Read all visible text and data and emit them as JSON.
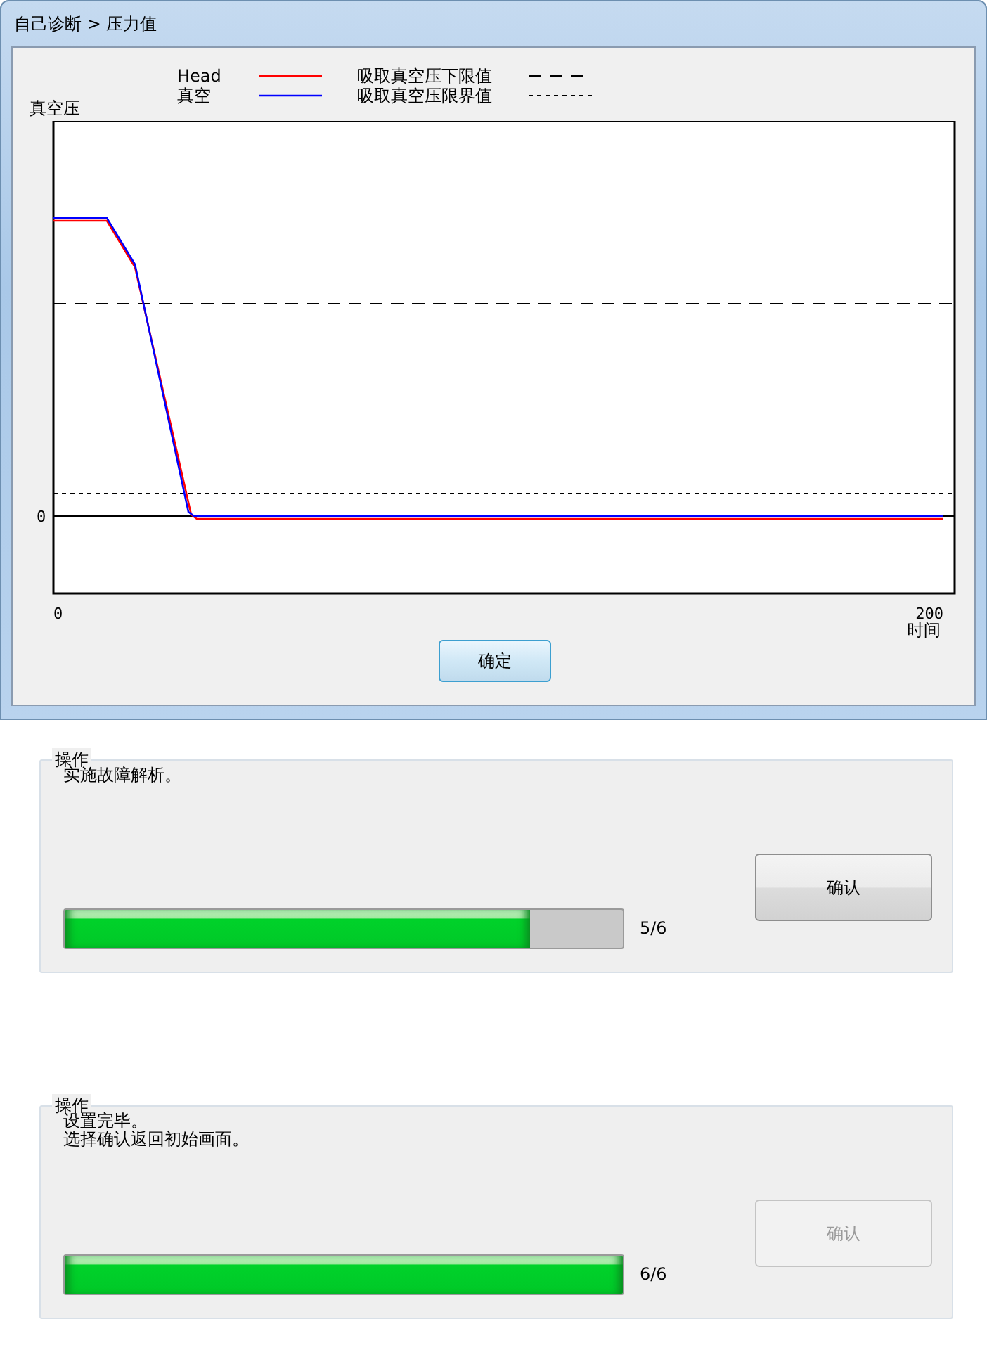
{
  "window": {
    "title": "自己诊断 > 压力值"
  },
  "chart": {
    "ylabel": "真空压",
    "xlabel": "时间",
    "y_tick": "0",
    "x_ticks": [
      "0",
      "200"
    ],
    "legend": [
      {
        "label": "Head",
        "color": "#ff0000",
        "kind": "solid"
      },
      {
        "label": "真空",
        "color": "#0000ff",
        "kind": "solid"
      },
      {
        "label": "吸取真空压下限值",
        "color": "#000000",
        "kind": "dashed"
      },
      {
        "label": "吸取真空压限界值",
        "color": "#000000",
        "kind": "dotted"
      }
    ]
  },
  "ok_button": "确定",
  "panels": [
    {
      "title": "操作",
      "message": [
        "实施故障解析。"
      ],
      "level": 0.833,
      "count": "5/6",
      "button": {
        "label": "确认",
        "disabled": false
      }
    },
    {
      "title": "操作",
      "message": [
        "设置完毕。",
        "选择确认返回初始画面。"
      ],
      "level": 1,
      "count": "6/6",
      "button": {
        "label": "确认",
        "disabled": true
      }
    }
  ]
}
